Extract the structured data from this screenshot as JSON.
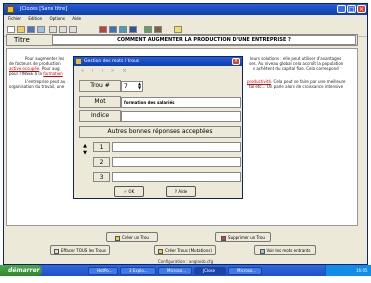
{
  "window": {
    "title": "JClozes [Sans titre]",
    "menu": [
      "Fichier",
      "Edition",
      "Options",
      "Aide"
    ]
  },
  "titre": {
    "label": "Titre",
    "value": "COMMENT AUGMENTER LA  PRODUCTION D'UNE ENTREPRISE ?"
  },
  "document": {
    "lines": [
      {
        "a": "Pour augmenter les",
        "b": "",
        "c": "leurs solutions : elle peut utiliser d'avantages"
      },
      {
        "a": "de facteurs de production",
        "b": "",
        "c": "ses. Au niveau global cela accroît la population"
      },
      {
        "a": "active occupée",
        "b": "",
        "c": ". Pour aug",
        "d": "s achètent du capital fixe. Cela correspond"
      },
      {
        "a": "pour l'INSEE à la",
        "b": "formation",
        "c": ""
      },
      {
        "a": "L'entreprise peut au",
        "b": "productivité",
        "c": ". Cela peut se faire par une meilleure"
      },
      {
        "a": "organisation du travail, une",
        "b": "",
        "c": "tal etc... On parle alors de croissance intensive"
      }
    ]
  },
  "bottom_buttons": {
    "create": "Créer un Trou",
    "delete": "Supprimer un Trou",
    "clear_all": "Effacer TOUS les Trous",
    "create_all": "Créer Trous (Mutations)",
    "view": "Voir les mots entrants"
  },
  "status": "Configuration : anglaisb.cfg",
  "taskbar": {
    "start": "démarrer",
    "tasks": [
      "HotPo...",
      "3 Explo...",
      "Microso...",
      "JClose",
      "Microso..."
    ],
    "clock": "16:05"
  },
  "dialog": {
    "title": "Gestion des mots / trous",
    "trou_label": "Trou #",
    "trou_number": "7",
    "mot_label": "Mot",
    "mot_value": "formation des salariés",
    "indice_label": "Indice",
    "indice_value": "",
    "alt_header": "Autres bonnes réponses acceptées",
    "alt_numbers": [
      "1",
      "2",
      "3"
    ],
    "alt_values": [
      "",
      "",
      ""
    ],
    "ok_label": "OK",
    "help_label": "Aide"
  },
  "colors": {
    "titlebar": "#0a3fb0",
    "taskbar": "#1f4fc8",
    "start": "#2d8a2d",
    "link_red": "#d00000"
  }
}
